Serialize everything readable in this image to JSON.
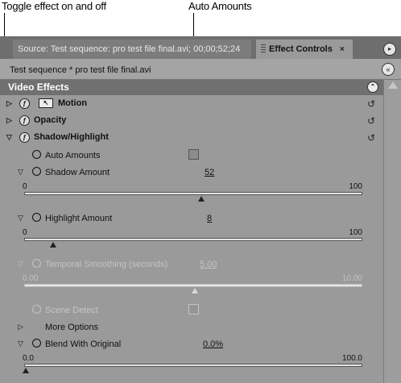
{
  "callouts": {
    "toggle_effect": "Toggle effect on and off",
    "auto_amounts": "Auto Amounts"
  },
  "tabs": {
    "source": "Source: Test sequence: pro test file final.avi; 00;00;52;24",
    "effect_controls": "Effect Controls",
    "close_glyph": "×",
    "menu_glyph": "▸"
  },
  "sequence": {
    "name": "Test sequence * pro test file final.avi",
    "toggle_glyph": "«"
  },
  "video_effects": {
    "header": "Video Effects",
    "collapse_glyph": "⌃",
    "effects": [
      {
        "label": "Motion",
        "icon": "motion-icon"
      },
      {
        "label": "Opacity",
        "icon": "fx-icon"
      },
      {
        "label": "Shadow/Highlight",
        "icon": "fx-icon"
      }
    ],
    "fx_glyph": "ƒ",
    "reset_glyph": "↺"
  },
  "properties": {
    "auto_amounts": {
      "label": "Auto Amounts",
      "checked": false
    },
    "shadow_amount": {
      "label": "Shadow Amount",
      "value": "52",
      "min": "0",
      "max": "100",
      "level": 0.52
    },
    "highlight_amount": {
      "label": "Highlight Amount",
      "value": "8",
      "min": "0",
      "max": "100",
      "level": 0.08
    },
    "temporal_smoothing": {
      "label": "Temporal Smoothing (seconds)",
      "value": "5.00",
      "min": "0.00",
      "max": "10.00",
      "level": 0.5
    },
    "scene_detect": {
      "label": "Scene Detect",
      "checked": false
    },
    "more_options": {
      "label": "More Options"
    },
    "blend_with_original": {
      "label": "Blend With Original",
      "value": "0.0%",
      "min": "0.0",
      "max": "100.0",
      "level": 0.0
    }
  },
  "colors": {
    "panel_bg": "#9a9a9a",
    "header_bg": "#707070",
    "disabled_text": "#c4c4c4"
  }
}
